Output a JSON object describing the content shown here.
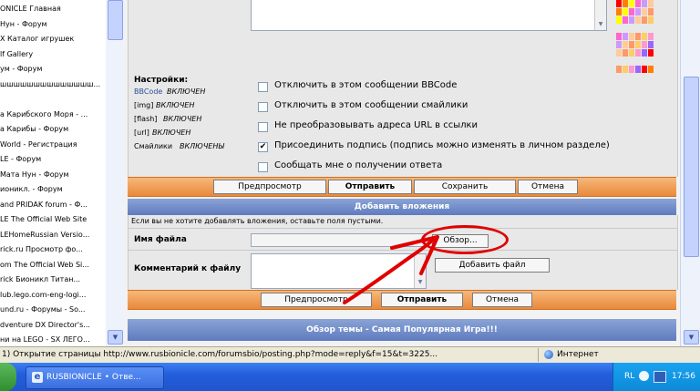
{
  "history": [
    "ONICLE Главная",
    "Нун - Форум",
    "X Каталог игрушек",
    "lf Gallery",
    "ум - Форум",
    "шшшшшшшшшшшшшш...",
    "",
    "а Карибского Моря - ...",
    "а Карибы - Форум",
    "World - Регистрация",
    "LE - Форум",
    "Мата Нун - Форум",
    "ионикл. - Форум",
    "and PRIDAK forum - Ф...",
    "LE The Official Web Site",
    "LEHomeRussian Versio...",
    "rick.ru Просмотр фо...",
    "om The Official Web Si...",
    "rick Бионикл Титан...",
    "lub.lego.com-eng-logi...",
    "und.ru - Форумы - So...",
    "dventure DX Director's...",
    "ни на LEGO - SX ЛЕГО..."
  ],
  "settings": {
    "title": "Настройки:",
    "bbcode_link": "BBCode",
    "bbcode_state": "ВКЛЮЧЕН",
    "img_tag": "[img]",
    "img_state": "ВКЛЮЧЕН",
    "flash_tag": "[flash]",
    "flash_state": "ВКЛЮЧЕН",
    "url_tag": "[url]",
    "url_state": "ВКЛЮЧЕН",
    "smilies_label": "Смайлики",
    "smilies_state": "ВКЛЮЧЕНЫ",
    "options": [
      {
        "label": "Отключить в этом сообщении BBCode",
        "checked": false
      },
      {
        "label": "Отключить в этом сообщении смайлики",
        "checked": false
      },
      {
        "label": "Не преобразовывать адреса URL в ссылки",
        "checked": false
      },
      {
        "label": "Присоединить подпись (подпись можно изменять в личном разделе)",
        "checked": true
      },
      {
        "label": "Сообщать мне о получении ответа",
        "checked": false
      }
    ],
    "check_mark": "✔"
  },
  "buttons1": {
    "preview": "Предпросмотр",
    "submit": "Отправить",
    "save": "Сохранить",
    "cancel": "Отмена"
  },
  "attach": {
    "header": "Добавить вложения",
    "hint": "Если вы не хотите добавлять вложения, оставьте поля пустыми.",
    "filename_label": "Имя файла",
    "browse": "Обзор...",
    "comment_label": "Комментарий к файлу",
    "add_file": "Добавить файл"
  },
  "buttons2": {
    "preview": "Предпросмотр",
    "submit": "Отправить",
    "cancel": "Отмена"
  },
  "topic_bar": "Обзор темы - Самая Популярная Игра!!!",
  "status": {
    "text": "1) Открытие страницы http://www.rusbionicle.com/forumsbio/posting.php?mode=reply&f=15&t=3225...",
    "zone": "Интернет"
  },
  "taskbar": {
    "window": "RUSBIONICLE • Отве...",
    "lang": "RL",
    "clock": "17:56"
  },
  "colors": {
    "accent_orange": "#e9893b",
    "header_blue": "#5f7bbf",
    "annotation_red": "#e00000"
  }
}
